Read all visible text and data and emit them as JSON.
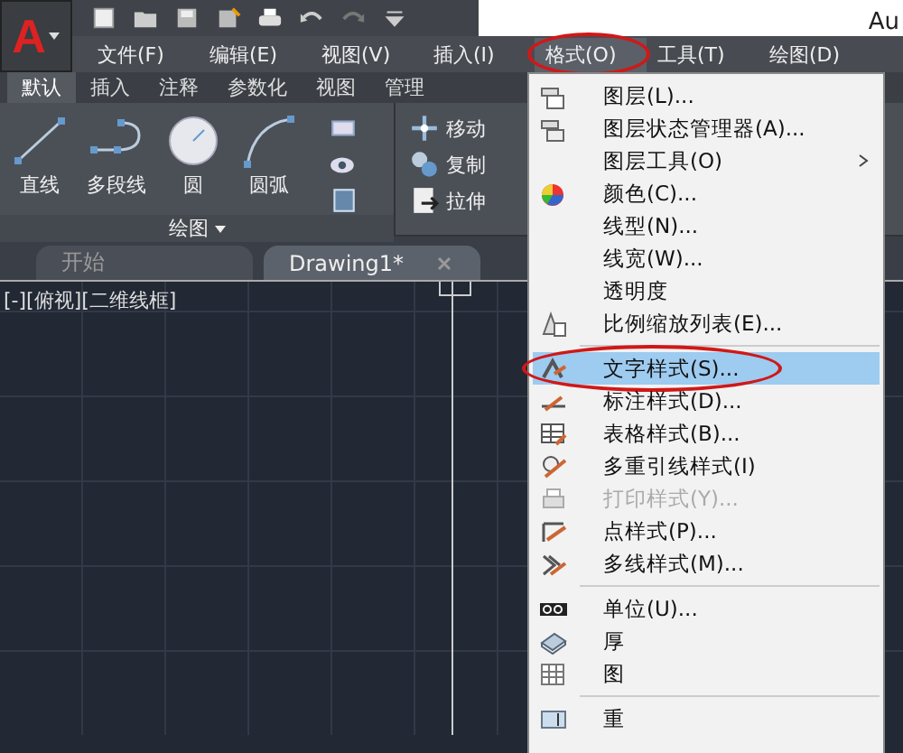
{
  "app_button": {
    "logo": "A"
  },
  "title": "Au",
  "menubar": [
    {
      "label": "文件(F)",
      "selected": false,
      "circled": false
    },
    {
      "label": "编辑(E)",
      "selected": false,
      "circled": false
    },
    {
      "label": "视图(V)",
      "selected": false,
      "circled": false
    },
    {
      "label": "插入(I)",
      "selected": false,
      "circled": false
    },
    {
      "label": "格式(O)",
      "selected": true,
      "circled": true
    },
    {
      "label": "工具(T)",
      "selected": false,
      "circled": false
    },
    {
      "label": "绘图(D)",
      "selected": false,
      "circled": false
    }
  ],
  "ribbon_tabs": [
    {
      "label": "默认",
      "selected": true
    },
    {
      "label": "插入",
      "selected": false
    },
    {
      "label": "注释",
      "selected": false
    },
    {
      "label": "参数化",
      "selected": false
    },
    {
      "label": "视图",
      "selected": false
    },
    {
      "label": "管理",
      "selected": false
    }
  ],
  "ribbon": {
    "draw_tools": [
      "直线",
      "多段线",
      "圆",
      "圆弧"
    ],
    "panel_label": "绘图",
    "modify_tools": [
      "移动",
      "复制",
      "拉伸"
    ]
  },
  "doc_tabs": [
    {
      "label": "开始",
      "selected": false
    },
    {
      "label": "Drawing1*",
      "selected": true
    }
  ],
  "viewport_label": "[-][俯视][二维线框]",
  "menu": {
    "items": [
      {
        "kind": "item",
        "label": "图层(L)...",
        "selected": false,
        "disabled": false,
        "submenu": false,
        "circled": false
      },
      {
        "kind": "item",
        "label": "图层状态管理器(A)...",
        "selected": false,
        "disabled": false,
        "submenu": false,
        "circled": false
      },
      {
        "kind": "item",
        "label": "图层工具(O)",
        "selected": false,
        "disabled": false,
        "submenu": true,
        "circled": false
      },
      {
        "kind": "item",
        "label": "颜色(C)...",
        "selected": false,
        "disabled": false,
        "submenu": false,
        "circled": false
      },
      {
        "kind": "item",
        "label": "线型(N)...",
        "selected": false,
        "disabled": false,
        "submenu": false,
        "circled": false
      },
      {
        "kind": "item",
        "label": "线宽(W)...",
        "selected": false,
        "disabled": false,
        "submenu": false,
        "circled": false
      },
      {
        "kind": "item",
        "label": "透明度",
        "selected": false,
        "disabled": false,
        "submenu": false,
        "circled": false
      },
      {
        "kind": "item",
        "label": "比例缩放列表(E)...",
        "selected": false,
        "disabled": false,
        "submenu": false,
        "circled": false
      },
      {
        "kind": "separator"
      },
      {
        "kind": "item",
        "label": "文字样式(S)...",
        "selected": true,
        "disabled": false,
        "submenu": false,
        "circled": true
      },
      {
        "kind": "item",
        "label": "标注样式(D)...",
        "selected": false,
        "disabled": false,
        "submenu": false,
        "circled": false
      },
      {
        "kind": "item",
        "label": "表格样式(B)...",
        "selected": false,
        "disabled": false,
        "submenu": false,
        "circled": false
      },
      {
        "kind": "item",
        "label": "多重引线样式(I)",
        "selected": false,
        "disabled": false,
        "submenu": false,
        "circled": false
      },
      {
        "kind": "item",
        "label": "打印样式(Y)...",
        "selected": false,
        "disabled": true,
        "submenu": false,
        "circled": false
      },
      {
        "kind": "item",
        "label": "点样式(P)...",
        "selected": false,
        "disabled": false,
        "submenu": false,
        "circled": false
      },
      {
        "kind": "item",
        "label": "多线样式(M)...",
        "selected": false,
        "disabled": false,
        "submenu": false,
        "circled": false
      },
      {
        "kind": "separator"
      },
      {
        "kind": "item",
        "label": "单位(U)...",
        "selected": false,
        "disabled": false,
        "submenu": false,
        "circled": false
      },
      {
        "kind": "item",
        "label": "厚",
        "selected": false,
        "disabled": false,
        "submenu": false,
        "circled": false
      },
      {
        "kind": "item",
        "label": "图",
        "selected": false,
        "disabled": false,
        "submenu": false,
        "circled": false
      },
      {
        "kind": "separator"
      },
      {
        "kind": "item",
        "label": "重",
        "selected": false,
        "disabled": false,
        "submenu": false,
        "circled": false
      }
    ]
  }
}
